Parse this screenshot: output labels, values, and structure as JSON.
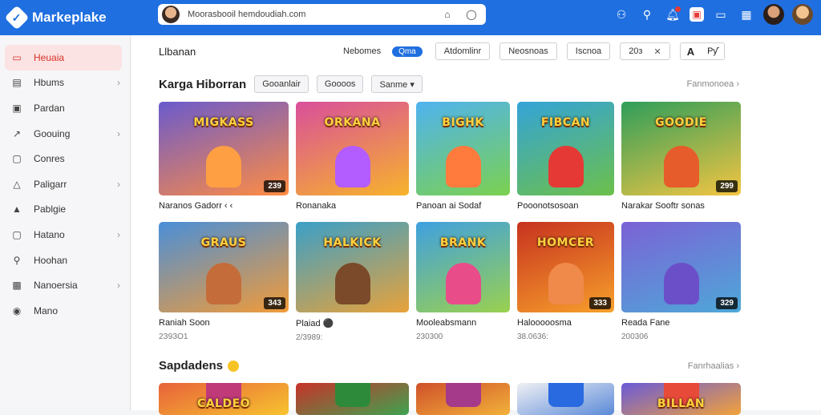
{
  "app": {
    "name": "Markeplake"
  },
  "search": {
    "value": "Moorasbooil hemdoudiah.com"
  },
  "sidebar": {
    "items": [
      {
        "label": "Heuaia",
        "icon": "home-icon",
        "glyph": "▭",
        "active": true,
        "chevron": false
      },
      {
        "label": "Hbums",
        "icon": "albums-icon",
        "glyph": "▤",
        "active": false,
        "chevron": true
      },
      {
        "label": "Pardan",
        "icon": "pardan-icon",
        "glyph": "▣",
        "active": false,
        "chevron": false
      },
      {
        "label": "Goouing",
        "icon": "trending-icon",
        "glyph": "↗",
        "active": false,
        "chevron": true
      },
      {
        "label": "Conres",
        "icon": "courses-icon",
        "glyph": "▢",
        "active": false,
        "chevron": false
      },
      {
        "label": "Paligarr",
        "icon": "triangle-icon",
        "glyph": "△",
        "active": false,
        "chevron": true
      },
      {
        "label": "Pablgie",
        "icon": "bag-icon",
        "glyph": "▲",
        "active": false,
        "chevron": false
      },
      {
        "label": "Hatano",
        "icon": "square-icon",
        "glyph": "▢",
        "active": false,
        "chevron": true
      },
      {
        "label": "Hoohan",
        "icon": "search-icon",
        "glyph": "⚲",
        "active": false,
        "chevron": false
      },
      {
        "label": "Nanoersia",
        "icon": "image-icon",
        "glyph": "▩",
        "active": false,
        "chevron": true
      },
      {
        "label": "Mano",
        "icon": "globe-icon",
        "glyph": "◉",
        "active": false,
        "chevron": false
      }
    ]
  },
  "filterbar": {
    "title": "Llbanan",
    "link": "Nebomes",
    "pill": "Qma",
    "buttons": [
      "Atdomlinr",
      "Neosnoas",
      "Iscnoa"
    ],
    "range": "20з",
    "close": "✕",
    "seg": [
      "A",
      "Pƴ"
    ]
  },
  "section1": {
    "title": "Karga Hiborran",
    "chips": [
      "Gooanlair",
      "Goooos",
      "Sanme ▾"
    ],
    "see_all": "Fanmonoea",
    "cards": [
      {
        "title": "MIGKASS",
        "bg": "#6a5acd",
        "bg2": "#ff8c42",
        "char": "#ff9f43",
        "badge": "239",
        "name": "Naranos Gadorr ‹ ‹",
        "sub": ""
      },
      {
        "title": "ORKANA",
        "bg": "#d94f9b",
        "bg2": "#f7b32b",
        "char": "#b35cff",
        "badge": "",
        "name": "Ronanaka",
        "sub": ""
      },
      {
        "title": "BIGHK",
        "bg": "#4fb3f0",
        "bg2": "#7bd14f",
        "char": "#ff7a3d",
        "badge": "",
        "name": "Panoan ai Sodaf",
        "sub": ""
      },
      {
        "title": "FIBCAN",
        "bg": "#34a3d8",
        "bg2": "#6cc04a",
        "char": "#e53935",
        "badge": "",
        "name": "Pooonotsosoan",
        "sub": ""
      },
      {
        "title": "GOODIE",
        "bg": "#2e9e5a",
        "bg2": "#f4c542",
        "char": "#e65c2a",
        "badge": "299",
        "name": "Narakar Sooftr sonas",
        "sub": ""
      }
    ]
  },
  "section2": {
    "cards": [
      {
        "title": "GRAUS",
        "bg": "#4a8fd8",
        "bg2": "#f29b38",
        "char": "#c46d3a",
        "badge": "343",
        "name": "Raniah Soon",
        "sub": "2З9ЗО1"
      },
      {
        "title": "HALKICK",
        "bg": "#3aa0c8",
        "bg2": "#e8a23a",
        "char": "#7b4a2a",
        "badge": "",
        "name": "Plaiad ⚫",
        "sub": "2/3989:"
      },
      {
        "title": "BRANK",
        "bg": "#3fa0e0",
        "bg2": "#9ad14f",
        "char": "#e84d8a",
        "badge": "",
        "name": "Mooleabsmann",
        "sub": "230300"
      },
      {
        "title": "HOMCER",
        "bg": "#c7321f",
        "bg2": "#f7a02b",
        "char": "#f08a4b",
        "badge": "333",
        "name": "Halooooosma",
        "sub": "38.0636:"
      },
      {
        "title": "",
        "bg": "#7b62d6",
        "bg2": "#4ea8d8",
        "char": "#6b4fc8",
        "badge": "329",
        "name": "Reada Fane",
        "sub": "200306"
      }
    ]
  },
  "section3": {
    "title": "Sapdadens",
    "see_all": "Fanrhaalias",
    "cards": [
      {
        "title": "CALDEO",
        "bg": "#e8623a",
        "bg2": "#f7c42f",
        "char": "#c03a7a"
      },
      {
        "title": "",
        "bg": "#c8322a",
        "bg2": "#3ea34f",
        "char": "#2d8a3a"
      },
      {
        "title": "",
        "bg": "#d0502a",
        "bg2": "#f2b23a",
        "char": "#a63a8a"
      },
      {
        "title": "",
        "bg": "#f0f0f4",
        "bg2": "#5a8ad8",
        "char": "#2a6ae0"
      },
      {
        "title": "BILLAN",
        "bg": "#6a5ad8",
        "bg2": "#f2a23a",
        "char": "#e84a3a"
      }
    ]
  },
  "colors": {
    "brand": "#1f6fe0",
    "active": "#d93025"
  }
}
